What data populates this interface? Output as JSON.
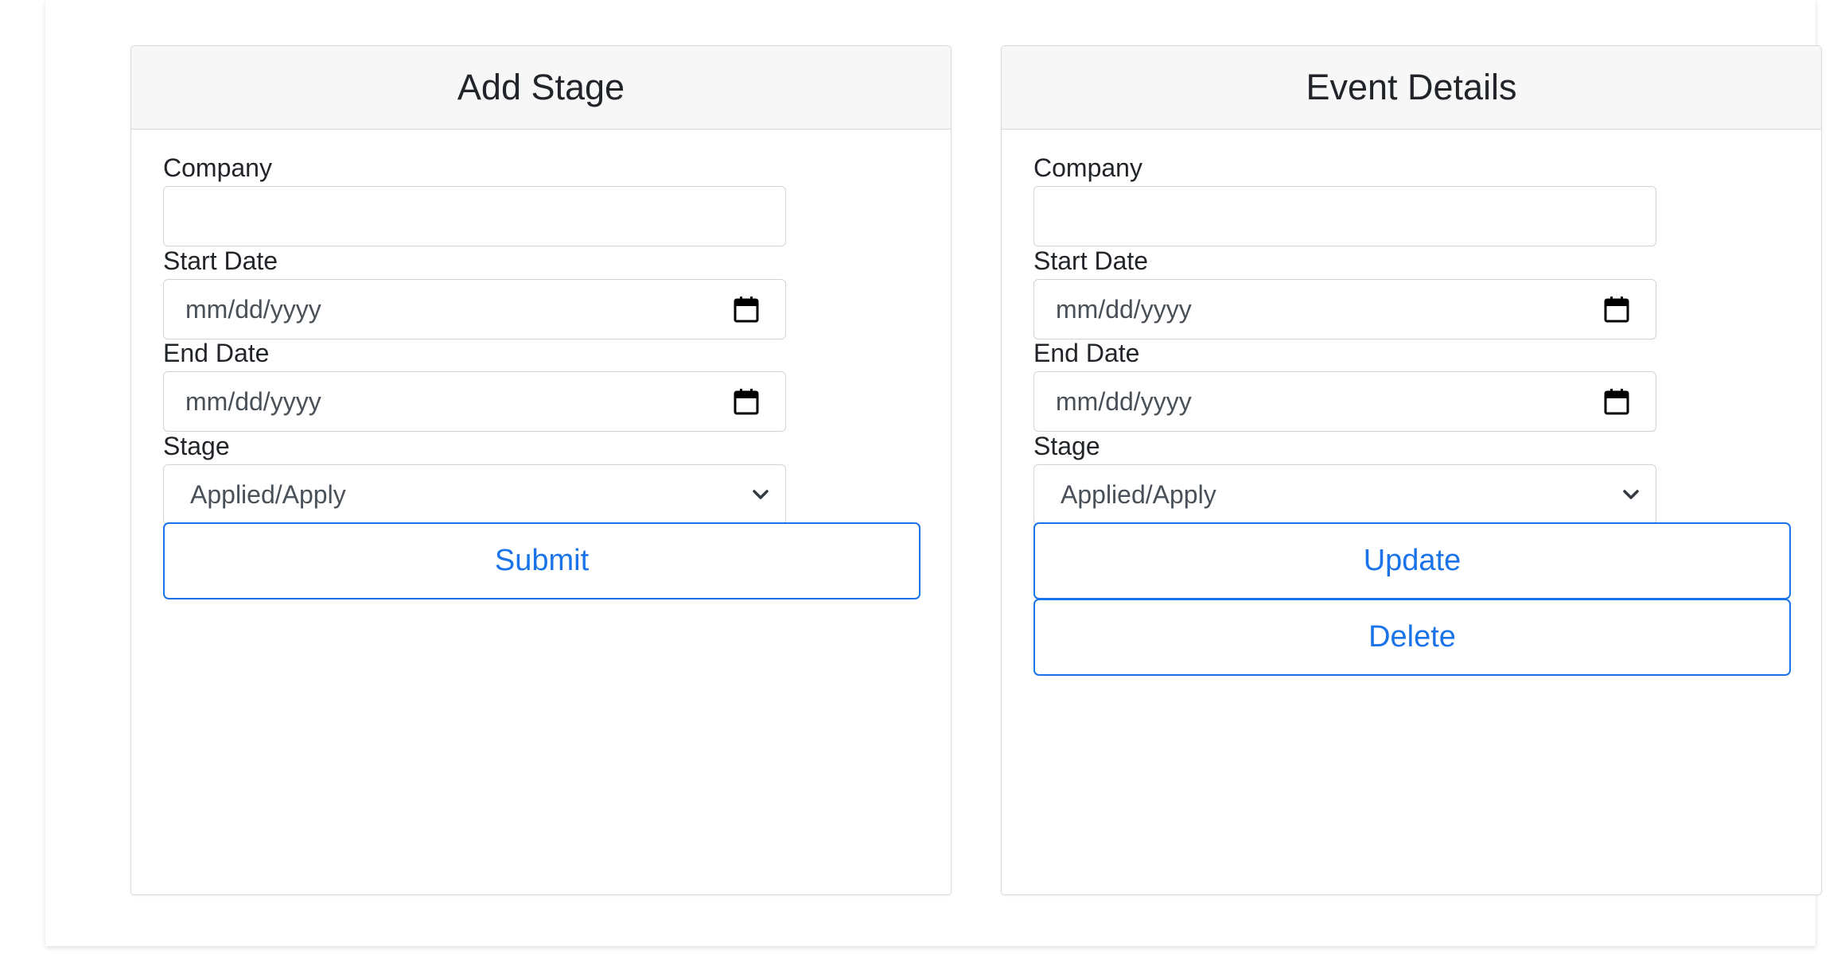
{
  "add_stage": {
    "title": "Add Stage",
    "company_label": "Company",
    "company_value": "",
    "start_date_label": "Start Date",
    "start_date_placeholder": "mm/dd/yyyy",
    "end_date_label": "End Date",
    "end_date_placeholder": "mm/dd/yyyy",
    "stage_label": "Stage",
    "stage_selected": "Applied/Apply",
    "submit_label": "Submit"
  },
  "event_details": {
    "title": "Event Details",
    "company_label": "Company",
    "company_value": "",
    "start_date_label": "Start Date",
    "start_date_placeholder": "mm/dd/yyyy",
    "end_date_label": "End Date",
    "end_date_placeholder": "mm/dd/yyyy",
    "stage_label": "Stage",
    "stage_selected": "Applied/Apply",
    "update_label": "Update",
    "delete_label": "Delete"
  },
  "colors": {
    "accent": "#1a73e8",
    "header_bg": "#f7f7f7",
    "border": "#ced4da"
  },
  "icons": {
    "date_picker": "calendar-icon",
    "select": "chevron-down-icon"
  }
}
